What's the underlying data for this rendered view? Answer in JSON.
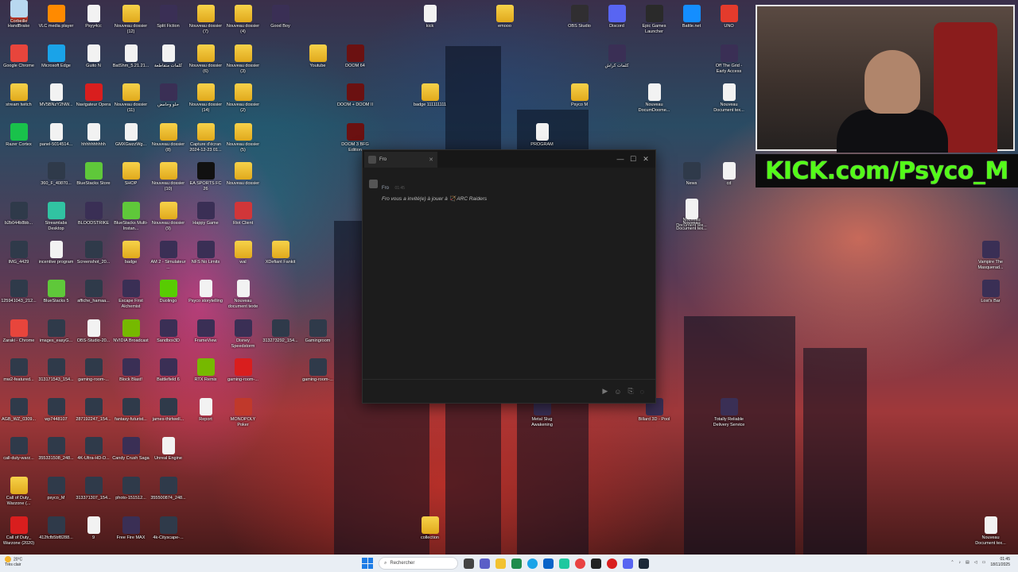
{
  "desktop_icons": [
    {
      "id": "handbrake",
      "label": "HandBrake",
      "icon": "pineapple-icon",
      "x": 0
    },
    {
      "id": "vlc",
      "label": "VLC media player",
      "icon": "cone-icon"
    },
    {
      "id": "psyy4cc",
      "label": "Psyy4cc",
      "icon": "file-icon"
    },
    {
      "id": "nd12",
      "label": "Nouveau dossier (12)",
      "icon": "folder-icon"
    },
    {
      "id": "split",
      "label": "Split Fiction",
      "icon": "game-icon"
    },
    {
      "id": "nd7",
      "label": "Nouveau dossier (7)",
      "icon": "folder-icon"
    },
    {
      "id": "nd4",
      "label": "Nouveau dossier (4)",
      "icon": "folder-icon"
    },
    {
      "id": "goodboy",
      "label": "Good Boy",
      "icon": "game-icon"
    },
    {
      "id": "chrome",
      "label": "Google Chrome",
      "icon": "chrome-icon"
    },
    {
      "id": "edge",
      "label": "Microsoft Edge",
      "icon": "edge-icon"
    },
    {
      "id": "guito",
      "label": "Guito N",
      "icon": "file-icon"
    },
    {
      "id": "batshm",
      "label": "BatShm_5.21.21...",
      "icon": "file-icon"
    },
    {
      "id": "arabic1",
      "label": "كلمات متقاطعة",
      "icon": "file-icon"
    },
    {
      "id": "nd6",
      "label": "Nouveau dossier (6)",
      "icon": "folder-icon"
    },
    {
      "id": "nd3",
      "label": "Nouveau dossier (3)",
      "icon": "folder-icon"
    },
    {
      "id": "youtube",
      "label": "Youtube",
      "icon": "folder-icon"
    },
    {
      "id": "doom64",
      "label": "DOOM 64",
      "icon": "doom-icon"
    },
    {
      "id": "stream",
      "label": "stream twitch",
      "icon": "folder-icon"
    },
    {
      "id": "mv5b",
      "label": "MV5BNzY2NW...",
      "icon": "file-icon"
    },
    {
      "id": "opera",
      "label": "Navigateur Opera",
      "icon": "opera-icon"
    },
    {
      "id": "nd11",
      "label": "Nouveau dossier (11)",
      "icon": "folder-icon"
    },
    {
      "id": "arabic2",
      "label": "حلو وحامض",
      "icon": "game-icon"
    },
    {
      "id": "nd14",
      "label": "Nouveau dossier (14)",
      "icon": "folder-icon"
    },
    {
      "id": "nd2",
      "label": "Nouveau dossier (2)",
      "icon": "folder-icon"
    },
    {
      "id": "doomdoom",
      "label": "DOOM + DOOM II",
      "icon": "doom-icon"
    },
    {
      "id": "badge",
      "label": "badge 111111111",
      "icon": "folder-icon"
    },
    {
      "id": "psycom",
      "label": "Psyco M",
      "icon": "folder-icon"
    },
    {
      "id": "nddocdoom",
      "label": "Nouveau DocumDoome...",
      "icon": "file-icon"
    },
    {
      "id": "ndoctex1",
      "label": "Nouveau Document tex...",
      "icon": "file-icon"
    },
    {
      "id": "razer",
      "label": "Razer Cortex",
      "icon": "razer-icon"
    },
    {
      "id": "panel",
      "label": "panel-5014514...",
      "icon": "file-icon"
    },
    {
      "id": "hhh",
      "label": "hhhhhhhhhh",
      "icon": "file-icon"
    },
    {
      "id": "gmx",
      "label": "GMXGwzzWg...",
      "icon": "file-icon"
    },
    {
      "id": "nd8",
      "label": "Nouveau dossier (8)",
      "icon": "folder-icon"
    },
    {
      "id": "capture",
      "label": "Capture d'écran 2024-12-23 01...",
      "icon": "folder-icon"
    },
    {
      "id": "nd5",
      "label": "Nouveau dossier (5)",
      "icon": "folder-icon"
    },
    {
      "id": "doom3",
      "label": "DOOM 3 BFG Edition",
      "icon": "doom-icon"
    },
    {
      "id": "program",
      "label": "PROGRAM",
      "icon": "file-icon"
    },
    {
      "id": "ndoctex2",
      "label": "Nouveau Document tex...",
      "icon": "file-icon"
    },
    {
      "id": "img360",
      "label": "360_F_40870...",
      "icon": "image-icon"
    },
    {
      "id": "bluestacks",
      "label": "BlueStacks Store",
      "icon": "bluestacks-icon"
    },
    {
      "id": "shop",
      "label": "SHOP",
      "icon": "folder-icon"
    },
    {
      "id": "nd10",
      "label": "Nouveau dossier (10)",
      "icon": "folder-icon"
    },
    {
      "id": "eafc",
      "label": "EA SPORTS FC 26",
      "icon": "ea-icon"
    },
    {
      "id": "nd",
      "label": "Nouveau dossier",
      "icon": "folder-icon"
    },
    {
      "id": "news",
      "label": "News",
      "icon": "image-icon"
    },
    {
      "id": "cd",
      "label": "cd",
      "icon": "file-icon"
    },
    {
      "id": "b2b",
      "label": "b2b044b8bb...",
      "icon": "image-icon"
    },
    {
      "id": "streamlabs",
      "label": "Streamlabs Desktop",
      "icon": "streamlabs-icon"
    },
    {
      "id": "bloodstrike",
      "label": "BLOODSTRIKE",
      "icon": "game-icon"
    },
    {
      "id": "bsmulti",
      "label": "BlueStacks Multi-Instan...",
      "icon": "bluestacks-icon"
    },
    {
      "id": "nd9",
      "label": "Nouveau dossier (9)",
      "icon": "folder-icon"
    },
    {
      "id": "happy",
      "label": "Happy Game",
      "icon": "game-icon"
    },
    {
      "id": "riot",
      "label": "Riot Client",
      "icon": "riot-icon"
    },
    {
      "id": "ndoctex3",
      "label": "Nouveau Document tex...",
      "icon": "file-icon"
    },
    {
      "id": "img4429",
      "label": "IMG_4429",
      "icon": "image-icon"
    },
    {
      "id": "incentive",
      "label": "incentive program",
      "icon": "file-icon"
    },
    {
      "id": "screenshot",
      "label": "Screenshot_20...",
      "icon": "image-icon"
    },
    {
      "id": "badge2",
      "label": "badge",
      "icon": "folder-icon"
    },
    {
      "id": "am2",
      "label": "AM 2 - Simulateur ...",
      "icon": "game-icon"
    },
    {
      "id": "nfs",
      "label": "NFS No Limits",
      "icon": "game-icon"
    },
    {
      "id": "wal",
      "label": "wal",
      "icon": "folder-icon"
    },
    {
      "id": "xdefiant",
      "label": "XDefiant Fankit",
      "icon": "folder-icon"
    },
    {
      "id": "vampire",
      "label": "Vampire The Masquerad...",
      "icon": "game-icon"
    },
    {
      "id": "img1259",
      "label": "125941043_212...",
      "icon": "image-icon"
    },
    {
      "id": "bs5",
      "label": "BlueStacks 5",
      "icon": "bluestacks-icon"
    },
    {
      "id": "affiche",
      "label": "affiche_hamaa...",
      "icon": "image-icon"
    },
    {
      "id": "escape",
      "label": "Escape First Alchemist",
      "icon": "game-icon"
    },
    {
      "id": "duolingo",
      "label": "Duolingo",
      "icon": "duolingo-icon"
    },
    {
      "id": "psycostory",
      "label": "Psyco storytelling",
      "icon": "file-icon"
    },
    {
      "id": "ndoctex4",
      "label": "Nouveau document texte",
      "icon": "file-icon"
    },
    {
      "id": "lostbar",
      "label": "Lost's Bar",
      "icon": "game-icon"
    },
    {
      "id": "zaraki",
      "label": "Zaraki - Chrome",
      "icon": "chrome-icon"
    },
    {
      "id": "images",
      "label": "images_easyG...",
      "icon": "image-icon"
    },
    {
      "id": "obsstudio20",
      "label": "OBS-Studio-20...",
      "icon": "file-icon"
    },
    {
      "id": "nvidia",
      "label": "NVIDIA Broadcast",
      "icon": "nvidia-icon"
    },
    {
      "id": "sandbox",
      "label": "Sandbox3D",
      "icon": "game-icon"
    },
    {
      "id": "frameview",
      "label": "FrameView",
      "icon": "game-icon"
    },
    {
      "id": "disney",
      "label": "Disney Speedstorm",
      "icon": "game-icon"
    },
    {
      "id": "img3132",
      "label": "313273292_154...",
      "icon": "image-icon"
    },
    {
      "id": "gamingroom",
      "label": "Gamingroom",
      "icon": "image-icon"
    },
    {
      "id": "mw2",
      "label": "mw2-featured...",
      "icon": "image-icon"
    },
    {
      "id": "img3131",
      "label": "313171543_154...",
      "icon": "image-icon"
    },
    {
      "id": "gamingroom2",
      "label": "gaming-room-...",
      "icon": "image-icon"
    },
    {
      "id": "blockblast",
      "label": "Block Blast!",
      "icon": "game-icon"
    },
    {
      "id": "bf6",
      "label": "Battlefield 6",
      "icon": "game-icon"
    },
    {
      "id": "rtx",
      "label": "RTX Remix",
      "icon": "nvidia-icon"
    },
    {
      "id": "gamingroom3",
      "label": "gaming-room-...",
      "icon": "opera-icon"
    },
    {
      "id": "gamingroom4",
      "label": "gaming-room-...",
      "icon": "image-icon"
    },
    {
      "id": "agb",
      "label": "AGB_WZ_0309...",
      "icon": "image-icon"
    },
    {
      "id": "wp",
      "label": "wp7448107",
      "icon": "image-icon"
    },
    {
      "id": "img2871",
      "label": "287192247_154...",
      "icon": "image-icon"
    },
    {
      "id": "fantasy",
      "label": "fantasy-futurist...",
      "icon": "image-icon"
    },
    {
      "id": "james",
      "label": "james-thirlwell...",
      "icon": "image-icon"
    },
    {
      "id": "report",
      "label": "Report",
      "icon": "file-icon"
    },
    {
      "id": "monopoly",
      "label": "MONOPOLY Poker",
      "icon": "monopoly-icon"
    },
    {
      "id": "metalslug",
      "label": "Metal Slug Awakening",
      "icon": "game-icon"
    },
    {
      "id": "billard",
      "label": "Billard 3D - Pool",
      "icon": "game-icon"
    },
    {
      "id": "totally",
      "label": "Totally Reliable Delivery Service",
      "icon": "game-icon"
    },
    {
      "id": "callduty",
      "label": "call-duty-warz...",
      "icon": "image-icon"
    },
    {
      "id": "img3535",
      "label": "355331508_248...",
      "icon": "image-icon"
    },
    {
      "id": "4kultra",
      "label": "4K-Ultra-HD-D...",
      "icon": "image-icon"
    },
    {
      "id": "candy",
      "label": "Candy Crush Saga",
      "icon": "game-icon"
    },
    {
      "id": "unreal",
      "label": "Unreal Engine",
      "icon": "file-icon"
    },
    {
      "id": "cod",
      "label": "Call of Duty_ Warzone (...",
      "icon": "folder-icon"
    },
    {
      "id": "psycom2",
      "label": "psyco_M",
      "icon": "image-icon"
    },
    {
      "id": "img3133",
      "label": "313371307_154...",
      "icon": "image-icon"
    },
    {
      "id": "photo",
      "label": "photo-151512...",
      "icon": "image-icon"
    },
    {
      "id": "img3550",
      "label": "355500874_248...",
      "icon": "image-icon"
    },
    {
      "id": "cod2",
      "label": "Call of Duty_ Warzone (2020)",
      "icon": "opera-icon"
    },
    {
      "id": "img412",
      "label": "412fcfb5bf8288...",
      "icon": "image-icon"
    },
    {
      "id": "nine",
      "label": "9",
      "icon": "file-icon"
    },
    {
      "id": "freefire",
      "label": "Free Fire MAX",
      "icon": "game-icon"
    },
    {
      "id": "4kcity",
      "label": "4k-Cityscape-...",
      "icon": "image-icon"
    },
    {
      "id": "collection",
      "label": "collection",
      "icon": "folder-icon"
    },
    {
      "id": "kick",
      "label": "kick",
      "icon": "file-icon"
    },
    {
      "id": "emooo",
      "label": "emooo",
      "icon": "folder-icon"
    },
    {
      "id": "obs",
      "label": "OBS Studio",
      "icon": "obs-icon"
    },
    {
      "id": "discord",
      "label": "Discord",
      "icon": "discord-icon"
    },
    {
      "id": "epic",
      "label": "Epic Games Launcher",
      "icon": "epic-icon"
    },
    {
      "id": "battlenet",
      "label": "Battle.net",
      "icon": "battlenet-icon"
    },
    {
      "id": "uno",
      "label": "UNO",
      "icon": "uno-icon"
    },
    {
      "id": "arabic3",
      "label": "كلمات كراش",
      "icon": "game-icon"
    },
    {
      "id": "offgrid",
      "label": "Off The Grid - Early Access",
      "icon": "game-icon"
    },
    {
      "id": "ndoctex5",
      "label": "Nouveau Document tex...",
      "icon": "file-icon"
    },
    {
      "id": "recycle",
      "label": "Corbeille",
      "icon": "recycle-bin-icon"
    }
  ],
  "chat_window": {
    "tab_title": "Fro",
    "message": {
      "sender": "Fro",
      "time": "01:45",
      "text": "Fro vous a invité(e) à jouer à 🏹 ARC Raiders"
    }
  },
  "banner": {
    "text": "KICK.com/Psyco_M"
  },
  "taskbar": {
    "weather_temp": "20°C",
    "weather_desc": "Très clair",
    "search_placeholder": "Rechercher",
    "time": "01:45",
    "date": "18/11/2025"
  }
}
